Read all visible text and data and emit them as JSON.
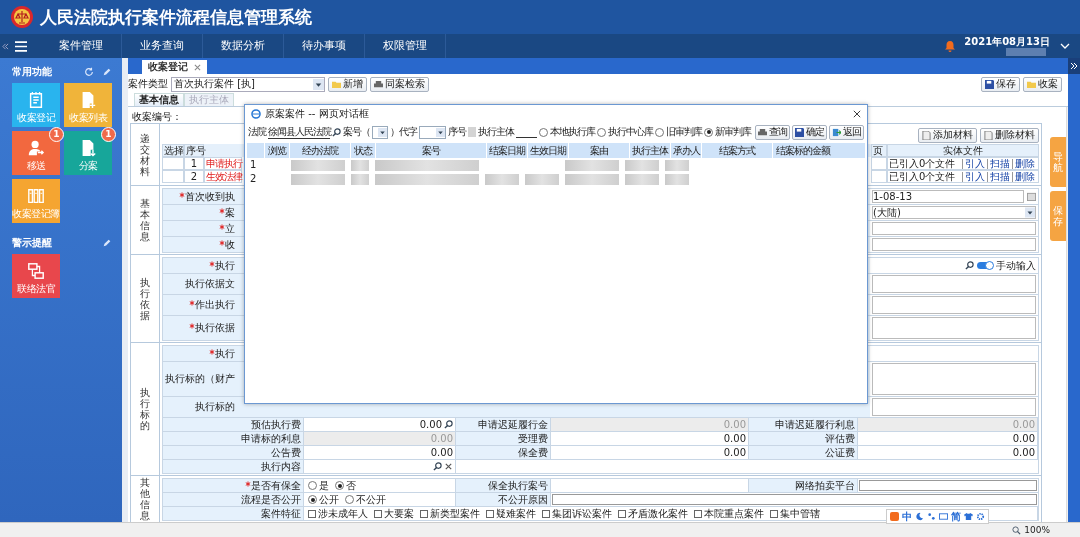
{
  "header": {
    "title": "人民法院执行案件流程信息管理系统"
  },
  "nav": {
    "items": [
      "案件管理",
      "业务查询",
      "数据分析",
      "待办事项",
      "权限管理"
    ],
    "date": "2021年08月13日"
  },
  "sidebar": {
    "sections": [
      {
        "title": "常用功能",
        "tiles": [
          {
            "label": "收案登记",
            "color": "#29b4ee"
          },
          {
            "label": "收案列表",
            "color": "#f0b43a"
          },
          {
            "label": "移送",
            "color": "#f2683f",
            "badge": "1"
          },
          {
            "label": "分案",
            "color": "#17a69a",
            "badge": "1"
          },
          {
            "label": "收案登记簿",
            "color": "#f5a531"
          }
        ]
      },
      {
        "title": "警示提醒",
        "tiles": [
          {
            "label": "联络法官",
            "color": "#e8474c"
          }
        ]
      }
    ]
  },
  "tabs": [
    {
      "label": "收案登记",
      "selected": true
    }
  ],
  "toolbar": {
    "case_type_label": "案件类型",
    "case_type_value": "首次执行案件 [执]",
    "buttons": [
      "新增",
      "同案检索"
    ],
    "right_buttons": [
      "保存",
      "收案"
    ]
  },
  "form_tabs": [
    {
      "label": "基本信息",
      "selected": true
    },
    {
      "label": "执行主体",
      "selected": false
    }
  ],
  "form": {
    "case_no_label": "收案编号：",
    "materials": {
      "section": "递交材料",
      "buttons": [
        "添加材料",
        "删除材料"
      ],
      "columns": [
        "选择",
        "序号",
        "页",
        "实体文件"
      ],
      "rows": [
        {
          "index": "1",
          "name": "申请执行",
          "files": "已引入0个文件",
          "actions": [
            "引入",
            "扫描",
            "删除"
          ]
        },
        {
          "index": "2",
          "name": "生效法律",
          "files": "已引入0个文件",
          "actions": [
            "引入",
            "扫描",
            "删除"
          ]
        }
      ]
    },
    "basic": {
      "section": "基本信息",
      "labels": [
        {
          "text": "首次收到执",
          "required": true
        },
        {
          "text": "案",
          "required": true
        },
        {
          "text": "立",
          "required": true
        },
        {
          "text": "收",
          "required": true
        }
      ],
      "date_value": "1-08-13",
      "region_value": "(大陆)"
    },
    "basis": {
      "section": "执行依据",
      "labels": [
        {
          "text": "执行",
          "required": true
        },
        {
          "text": "执行依据文",
          "required": false
        },
        {
          "text": "作出执行",
          "required": true
        },
        {
          "text": "执行依据",
          "required": true
        }
      ],
      "manual_input": {
        "label": "手动输入",
        "on": true
      }
    },
    "subject": {
      "section": "执行标的",
      "labels": [
        {
          "text": "执行",
          "required": true
        },
        {
          "text": "执行标的（财产",
          "required": false
        },
        {
          "text": "执行标的",
          "required": false
        }
      ],
      "fees": [
        {
          "label": "预估执行费",
          "value": "0.00",
          "disabled": false,
          "kind": "search"
        },
        {
          "label": "申请迟延履行金",
          "value": "0.00",
          "disabled": true,
          "kind": "plain"
        },
        {
          "label": "申请迟延履行利息",
          "value": "0.00",
          "disabled": true,
          "kind": "plain"
        },
        {
          "label": "申请标的利息",
          "value": "0.00",
          "disabled": true,
          "kind": "plain"
        },
        {
          "label": "受理费",
          "value": "0.00",
          "disabled": false,
          "kind": "plain"
        },
        {
          "label": "评估费",
          "value": "0.00",
          "disabled": false,
          "kind": "plain"
        },
        {
          "label": "公告费",
          "value": "0.00",
          "disabled": false,
          "kind": "plain"
        },
        {
          "label": "保全费",
          "value": "0.00",
          "disabled": false,
          "kind": "plain"
        },
        {
          "label": "公证费",
          "value": "0.00",
          "disabled": false,
          "kind": "plain"
        }
      ],
      "content_label": "执行内容"
    },
    "other": {
      "section": "其他信息",
      "preservation": {
        "label": "是否有保全",
        "required": true,
        "options": [
          {
            "label": "是",
            "selected": false
          },
          {
            "label": "否",
            "selected": true
          }
        ]
      },
      "preservation_no_label": "保全执行案号",
      "auction_label": "网络拍卖平台",
      "public": {
        "label": "流程是否公开",
        "options": [
          {
            "label": "公开",
            "selected": true
          },
          {
            "label": "不公开",
            "selected": false
          }
        ]
      },
      "nonpublic_reason_label": "不公开原因",
      "features": {
        "label": "案件特征",
        "options": [
          {
            "label": "涉未成年人",
            "checked": false
          },
          {
            "label": "大要案",
            "checked": false
          },
          {
            "label": "新类型案件",
            "checked": false
          },
          {
            "label": "疑难案件",
            "checked": false
          },
          {
            "label": "集团诉讼案件",
            "checked": false
          },
          {
            "label": "矛盾激化案件",
            "checked": false
          },
          {
            "label": "本院重点案件",
            "checked": false
          },
          {
            "label": "集中管辖",
            "checked": false
          }
        ]
      }
    }
  },
  "side_tabs": [
    "导航",
    "保存"
  ],
  "dialog": {
    "title": "原案案件 -- 网页对话框",
    "court_label": "法院",
    "court_value": "徐闻县人民法院",
    "case_no_label": "案号（",
    "code_label": "）代字",
    "seq_label": "序号",
    "subject_label": "执行主体",
    "sources": [
      {
        "label": "本地执行库",
        "selected": false
      },
      {
        "label": "执行中心库",
        "selected": false
      },
      {
        "label": "旧审判库",
        "selected": false
      },
      {
        "label": "新审判库",
        "selected": true
      }
    ],
    "buttons": [
      "查询",
      "确定",
      "返回"
    ],
    "columns": [
      "浏览",
      "经办法院",
      "状态",
      "案号",
      "结案日期",
      "生效日期",
      "案由",
      "执行主体",
      "承办人",
      "结案方式",
      "结案标的金额"
    ],
    "rows": [
      {
        "index": "1"
      },
      {
        "index": "2"
      }
    ]
  },
  "ime_bar": {
    "items": [
      "中",
      "简"
    ]
  },
  "status_bar": {
    "zoom": "100%"
  }
}
